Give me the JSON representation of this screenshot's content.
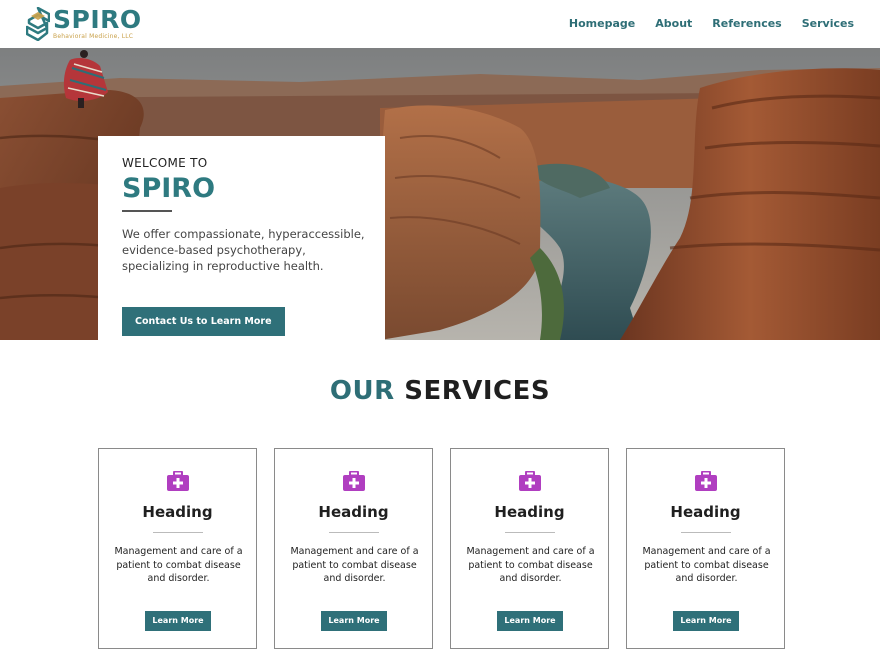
{
  "header": {
    "logo_name": "SPIRO",
    "logo_subtitle": "Behavioral Medicine, LLC",
    "nav": [
      "Homepage",
      "About",
      "References",
      "Services"
    ]
  },
  "hero": {
    "welcome": "WELCOME TO",
    "brand": "SPIRO",
    "intro": "We offer compassionate, hyperaccessible, evidence-based psychotherapy, specializing in reproductive health.",
    "cta_label": "Contact Us to Learn More"
  },
  "services": {
    "title_accent": "OUR",
    "title_rest": "SERVICES",
    "cards": [
      {
        "heading": "Heading",
        "text": "Management and care of a patient to combat disease and disorder.",
        "button": "Learn More",
        "icon": "medical-kit-icon"
      },
      {
        "heading": "Heading",
        "text": "Management and care of a patient to combat disease and disorder.",
        "button": "Learn More",
        "icon": "medical-kit-icon"
      },
      {
        "heading": "Heading",
        "text": "Management and care of a patient to combat disease and disorder.",
        "button": "Learn More",
        "icon": "medical-kit-icon"
      },
      {
        "heading": "Heading",
        "text": "Management and care of a patient to combat disease and disorder.",
        "button": "Learn More",
        "icon": "medical-kit-icon"
      }
    ]
  },
  "colors": {
    "brand_teal": "#2e7a80",
    "button_teal": "#2f7079",
    "logo_gold": "#c9a14a",
    "icon_magenta": "#b03ec0"
  }
}
